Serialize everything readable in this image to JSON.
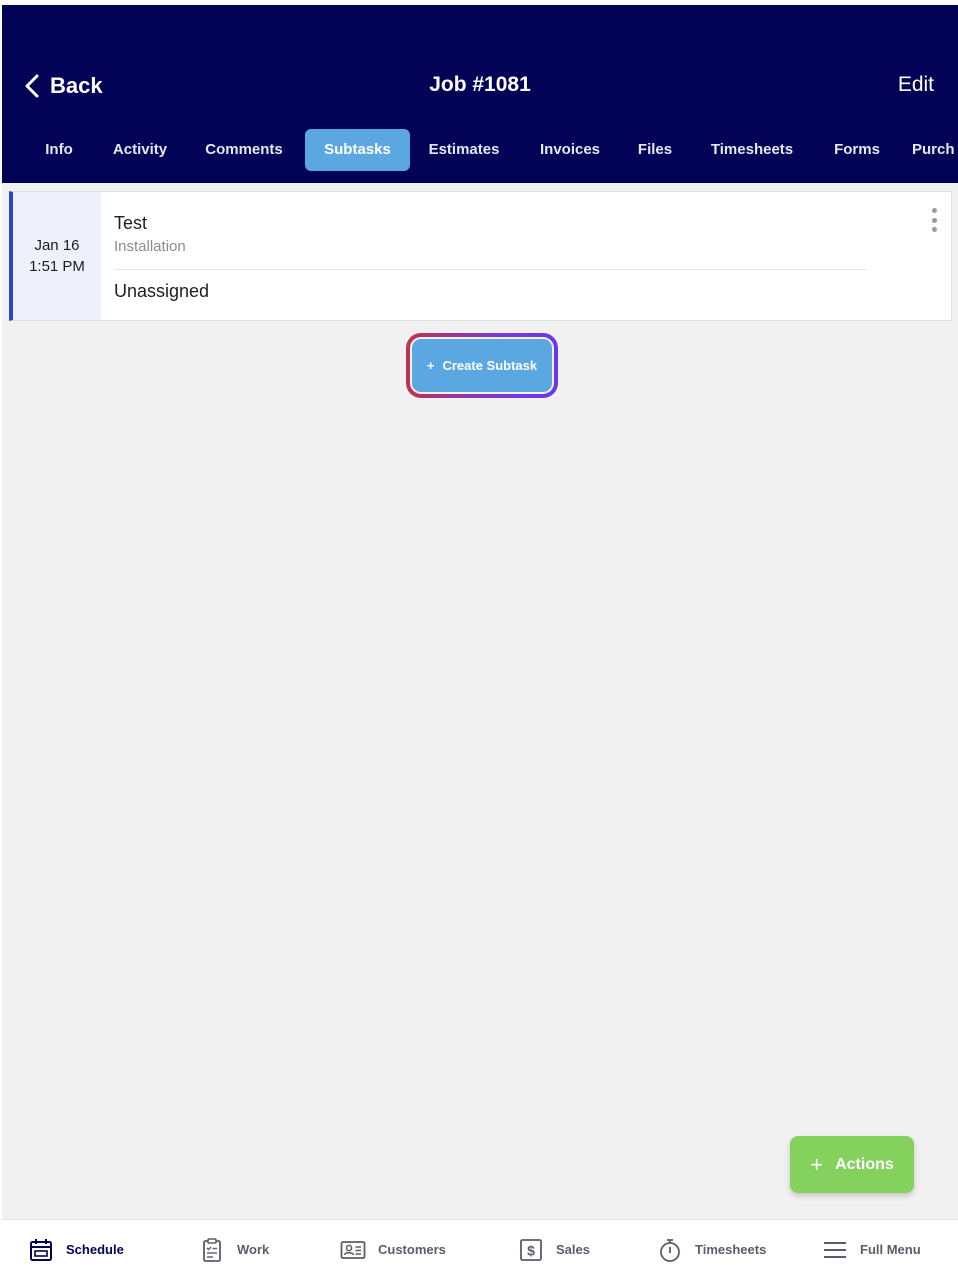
{
  "header": {
    "back_label": "Back",
    "title": "Job #1081",
    "edit_label": "Edit"
  },
  "tabs": [
    {
      "label": "Info"
    },
    {
      "label": "Activity"
    },
    {
      "label": "Comments"
    },
    {
      "label": "Subtasks",
      "active": true
    },
    {
      "label": "Estimates"
    },
    {
      "label": "Invoices"
    },
    {
      "label": "Files"
    },
    {
      "label": "Timesheets"
    },
    {
      "label": "Forms"
    },
    {
      "label": "Purch"
    }
  ],
  "subtask": {
    "date": "Jan 16",
    "time": "1:51 PM",
    "title": "Test",
    "type": "Installation",
    "assignee": "Unassigned"
  },
  "create_button": {
    "icon": "+",
    "label": "Create Subtask"
  },
  "actions_button": {
    "icon": "+",
    "label": "Actions"
  },
  "bottom_nav": [
    {
      "label": "Schedule",
      "icon": "calendar-icon",
      "active": true
    },
    {
      "label": "Work",
      "icon": "clipboard-icon"
    },
    {
      "label": "Customers",
      "icon": "contact-card-icon"
    },
    {
      "label": "Sales",
      "icon": "dollar-icon"
    },
    {
      "label": "Timesheets",
      "icon": "stopwatch-icon"
    },
    {
      "label": "Full Menu",
      "icon": "menu-icon"
    }
  ],
  "colors": {
    "header_bg": "#020356",
    "active_tab": "#5ba7e2",
    "card_accent": "#2a47c9",
    "actions_bg": "#84d15e",
    "page_bg": "#f1f1f1"
  }
}
